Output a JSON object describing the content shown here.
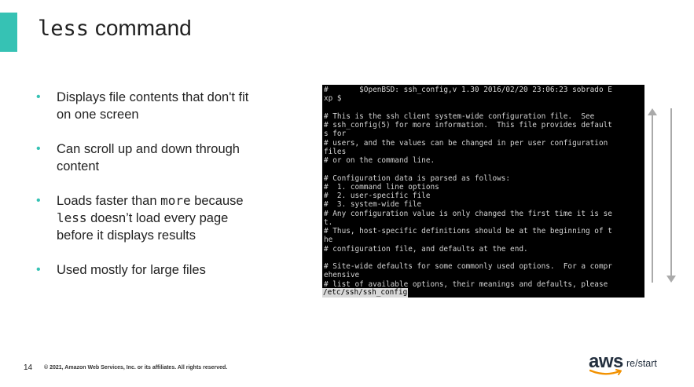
{
  "slide": {
    "title_command": "less",
    "title_rest": "command",
    "bullets": [
      {
        "text": "Displays file contents that don't fit on one screen"
      },
      {
        "text": "Can scroll up and down through content"
      },
      {
        "part1": "Loads faster than ",
        "code1": "more",
        "part2": " because ",
        "code2": "less",
        "part3": " doesn’t load every page before it displays results"
      },
      {
        "text": "Used mostly for large files"
      }
    ],
    "terminal_lines": [
      "#       $OpenBSD: ssh_config,v 1.30 2016/02/20 23:06:23 sobrado E",
      "xp $",
      "",
      "# This is the ssh client system-wide configuration file.  See",
      "# ssh_config(5) for more information.  This file provides default",
      "s for",
      "# users, and the values can be changed in per user configuration",
      "files",
      "# or on the command line.",
      "",
      "# Configuration data is parsed as follows:",
      "#  1. command line options",
      "#  2. user-specific file",
      "#  3. system-wide file",
      "# Any configuration value is only changed the first time it is se",
      "t.",
      "# Thus, host-specific definitions should be at the beginning of t",
      "he",
      "# configuration file, and defaults at the end.",
      "",
      "# Site-wide defaults for some commonly used options.  For a compr",
      "ehensive",
      "# list of available options, their meanings and defaults, please"
    ],
    "terminal_prompt": "/etc/ssh/ssh_config",
    "slide_number": "14",
    "copyright": "© 2021, Amazon Web Services, Inc. or its affiliates. All rights reserved.",
    "logo_aws": "aws",
    "logo_restart": "re/start",
    "accent_color": "#36c2b4"
  }
}
